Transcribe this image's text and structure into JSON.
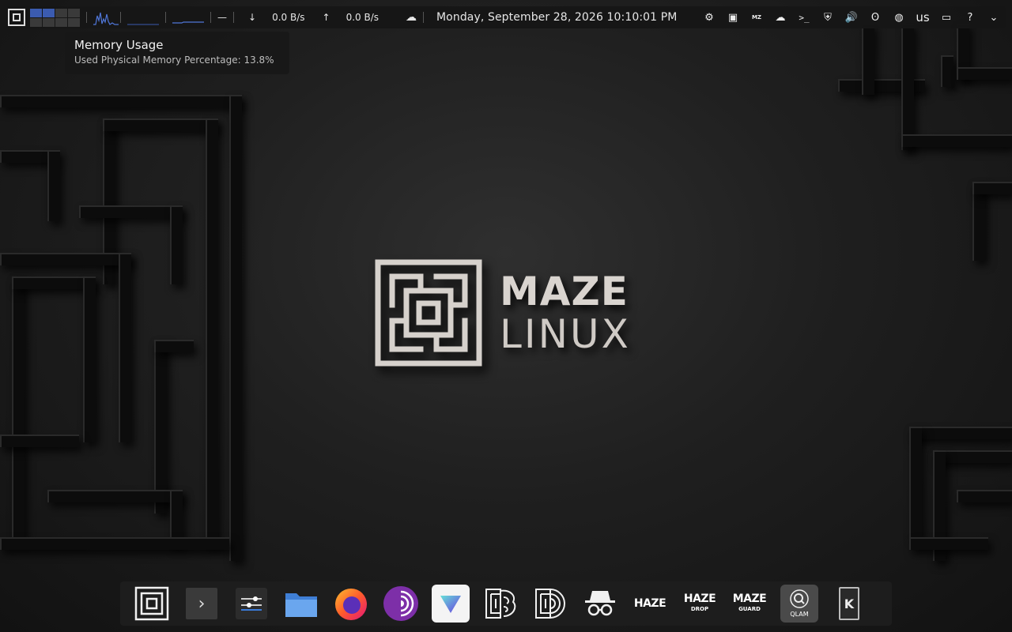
{
  "top_panel": {
    "net_down": "0.0 B/s",
    "net_up": "0.0 B/s",
    "clock": "Monday, September 28, 2026 10:10:01 PM",
    "keyboard_layout": "us"
  },
  "tooltip": {
    "title": "Memory Usage",
    "body": "Used Physical Memory Percentage: 13.8%"
  },
  "brand": {
    "line1": "MAZE",
    "line2": "LINUX"
  },
  "dock": {
    "haze_label": "HAZE",
    "haze_drop_line1": "HAZE",
    "haze_drop_line2": "DROP",
    "maze_guard_line1": "MAZE",
    "maze_guard_line2": "GUARD",
    "qlam_label": "QLAM"
  },
  "colors": {
    "accent": "#3b5bb0",
    "panel_bg": "#161616",
    "dock_bg": "#1e1e1e"
  }
}
